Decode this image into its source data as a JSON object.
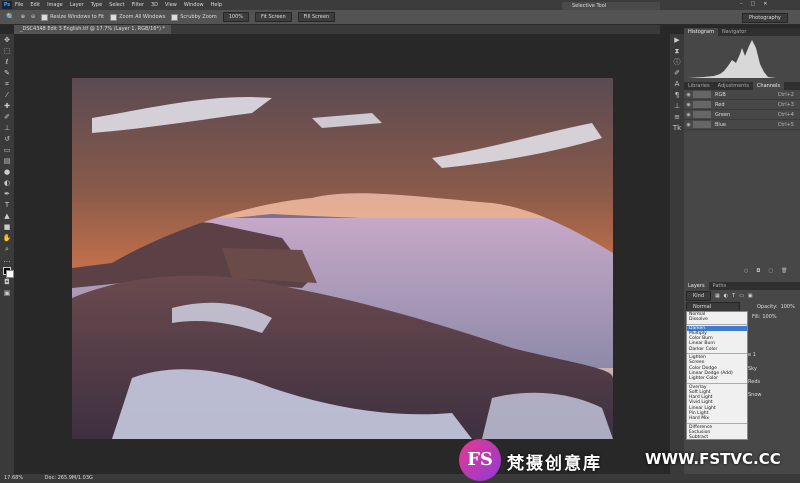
{
  "app": {
    "logo": "Ps",
    "menu": [
      "File",
      "Edit",
      "Image",
      "Layer",
      "Type",
      "Select",
      "Filter",
      "3D",
      "View",
      "Window",
      "Help"
    ],
    "window_title": "Selective Tool",
    "workspace": "Photography"
  },
  "options": {
    "zoom_labels": [
      "Resize Windows to Fit",
      "Zoom All Windows",
      "Scrubby Zoom"
    ],
    "zoom_value": "100%",
    "fit_screen": "Fit Screen",
    "fill_screen": "Fill Screen"
  },
  "document": {
    "tab": "_DSC4348 Edit 3 English.tif @ 17.7% (Layer 1, RGB/16*) *"
  },
  "status": {
    "zoom": "17.68%",
    "doc": "Doc: 265.9M/1.03G"
  },
  "panels": {
    "top_tabs": [
      "Histogram",
      "Navigator"
    ],
    "mid_tabs": [
      "Libraries",
      "Adjustments",
      "Channels"
    ],
    "channels": [
      {
        "name": "RGB",
        "shortcut": "Ctrl+2"
      },
      {
        "name": "Red",
        "shortcut": "Ctrl+3"
      },
      {
        "name": "Green",
        "shortcut": "Ctrl+4"
      },
      {
        "name": "Blue",
        "shortcut": "Ctrl+5"
      }
    ],
    "layers_tabs": [
      "Layers",
      "Paths"
    ],
    "kind": "Kind",
    "blend_value": "Normal",
    "opacity_label": "Opacity:",
    "opacity": "100%",
    "fill_label": "Fill:",
    "fill": "100%",
    "layer_hints": [
      "e 1",
      "Sky",
      "Reds",
      "Snow"
    ]
  },
  "blend_modes": [
    [
      "Normal",
      "Dissolve"
    ],
    [
      "Darken",
      "Multiply",
      "Color Burn",
      "Linear Burn",
      "Darker Color"
    ],
    [
      "Lighten",
      "Screen",
      "Color Dodge",
      "Linear Dodge (Add)",
      "Lighter Color"
    ],
    [
      "Overlay",
      "Soft Light",
      "Hard Light",
      "Vivid Light",
      "Linear Light",
      "Pin Light",
      "Hard Mix"
    ],
    [
      "Difference",
      "Exclusion",
      "Subtract"
    ]
  ],
  "blend_highlight": "Darken",
  "watermark": {
    "logo": "FS",
    "text": "梵摄创意库",
    "url": "WWW.FSTVC.CC"
  }
}
